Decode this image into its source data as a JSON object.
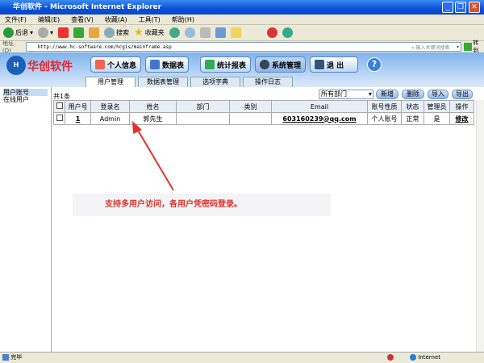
{
  "window": {
    "title": "华创软件 - Microsoft Internet Explorer"
  },
  "menu": [
    "文件(F)",
    "编辑(E)",
    "查看(V)",
    "收藏(A)",
    "工具(T)",
    "帮助(H)"
  ],
  "toolbar": {
    "back": "后退",
    "search": "搜索",
    "favorites": "收藏夹"
  },
  "address": {
    "label": "地址(D)",
    "url": "http://www.hc-software.com/hcgis/mainframe.asp",
    "search_placeholder": "←输入关键词搜索",
    "go": "转到"
  },
  "app": {
    "logo": "华创软件",
    "nav": [
      "个人信息",
      "数据表",
      "统计报表",
      "系统管理",
      "退 出"
    ],
    "help": "?",
    "tabs": [
      "用户管理",
      "数据表管理",
      "选项字典",
      "操作日志"
    ]
  },
  "sidebar": [
    "用户账号",
    "在线用户"
  ],
  "main": {
    "count": "共1条",
    "dept_select": "所有部门",
    "buttons": [
      "新增",
      "删除",
      "导入",
      "导出"
    ],
    "columns": [
      "用户号",
      "登录名",
      "姓名",
      "部门",
      "类别",
      "Email",
      "账号性质",
      "状态",
      "管理员",
      "操作"
    ],
    "rows": [
      [
        "1",
        "Admin",
        "郭先生",
        "",
        "",
        "603160239@qq.com",
        "个人账号",
        "正常",
        "是",
        "修改"
      ]
    ]
  },
  "annotation": "支持多用户访问，各用户凭密码登录。",
  "statusbar": {
    "text": "完毕",
    "zone": "Internet"
  }
}
